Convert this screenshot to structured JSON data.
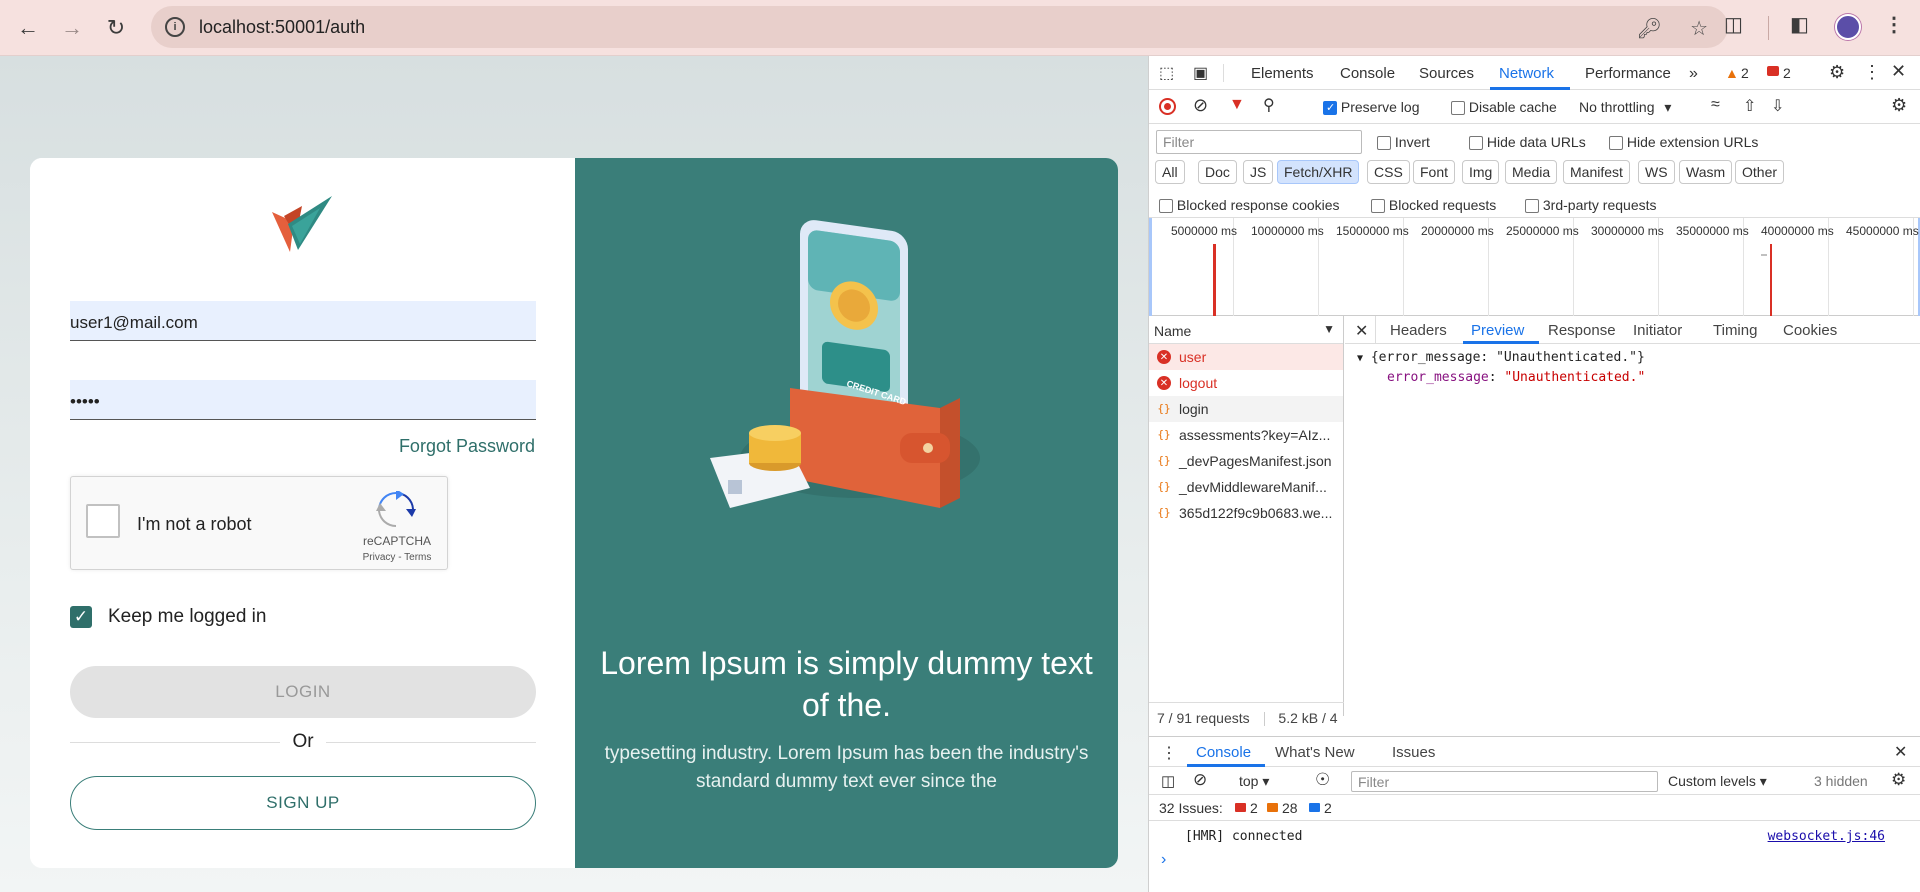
{
  "browser": {
    "url": "localhost:50001/auth",
    "back_icon": "arrow-left",
    "forward_icon": "arrow-right",
    "reload_icon": "reload"
  },
  "login": {
    "email_value": "user1@mail.com",
    "password_value": "•••••",
    "forgot_label": "Forgot Password",
    "recaptcha_label": "I'm not a robot",
    "recaptcha_brand": "reCAPTCHA",
    "recaptcha_links": "Privacy - Terms",
    "keep_logged_label": "Keep me logged in",
    "keep_logged_checked": true,
    "login_button": "LOGIN",
    "or_label": "Or",
    "signup_button": "SIGN UP",
    "wallet_card_text": "CREDIT CARD"
  },
  "hero": {
    "title": "Lorem Ipsum is simply dummy text of the.",
    "subtitle": "typesetting industry. Lorem Ipsum has been the industry's standard dummy text ever since the"
  },
  "devtools": {
    "tabs": [
      "Elements",
      "Console",
      "Sources",
      "Network",
      "Performance"
    ],
    "active_tab": "Network",
    "warning_count": "2",
    "error_count": "2",
    "preserve_log": "Preserve log",
    "disable_cache": "Disable cache",
    "throttling": "No throttling",
    "filter_placeholder": "Filter",
    "invert": "Invert",
    "hide_data_urls": "Hide data URLs",
    "hide_extension_urls": "Hide extension URLs",
    "type_filters": [
      "All",
      "Doc",
      "JS",
      "Fetch/XHR",
      "CSS",
      "Font",
      "Img",
      "Media",
      "Manifest",
      "WS",
      "Wasm",
      "Other"
    ],
    "active_type_filter": "Fetch/XHR",
    "blocked_response_cookies": "Blocked response cookies",
    "blocked_requests": "Blocked requests",
    "third_party": "3rd-party requests",
    "timeline_labels": [
      "5000000 ms",
      "10000000 ms",
      "15000000 ms",
      "20000000 ms",
      "25000000 ms",
      "30000000 ms",
      "35000000 ms",
      "40000000 ms",
      "45000000 ms"
    ],
    "name_header": "Name",
    "requests": [
      {
        "name": "user",
        "status": "error"
      },
      {
        "name": "logout",
        "status": "error"
      },
      {
        "name": "login",
        "status": "ok"
      },
      {
        "name": "assessments?key=AIz...",
        "status": "ok"
      },
      {
        "name": "_devPagesManifest.json",
        "status": "ok"
      },
      {
        "name": "_devMiddlewareManif...",
        "status": "ok"
      },
      {
        "name": "365d122f9c9b0683.we...",
        "status": "ok"
      }
    ],
    "detail_tabs": [
      "Headers",
      "Preview",
      "Response",
      "Initiator",
      "Timing",
      "Cookies"
    ],
    "active_detail_tab": "Preview",
    "preview_summary_open": "{error_message: ",
    "preview_summary_value": "\"Unauthenticated.\"",
    "preview_summary_close": "}",
    "preview_key": "error_message",
    "preview_value": "\"Unauthenticated.\"",
    "request_count": "7 / 91 requests",
    "transfer_size": "5.2 kB / 4",
    "drawer_tabs": [
      "Console",
      "What's New",
      "Issues"
    ],
    "active_drawer_tab": "Console",
    "context": "top",
    "console_filter_placeholder": "Filter",
    "levels": "Custom levels",
    "hidden": "3 hidden",
    "issues_label": "32 Issues:",
    "issues_errors": "2",
    "issues_warnings": "28",
    "issues_info": "2",
    "console_message": "[HMR] connected",
    "console_source": "websocket.js:46",
    "prompt": "›"
  },
  "colors": {
    "brand_teal": "#3a7e79",
    "error_red": "#d93025",
    "devtools_blue": "#1a73e8"
  }
}
